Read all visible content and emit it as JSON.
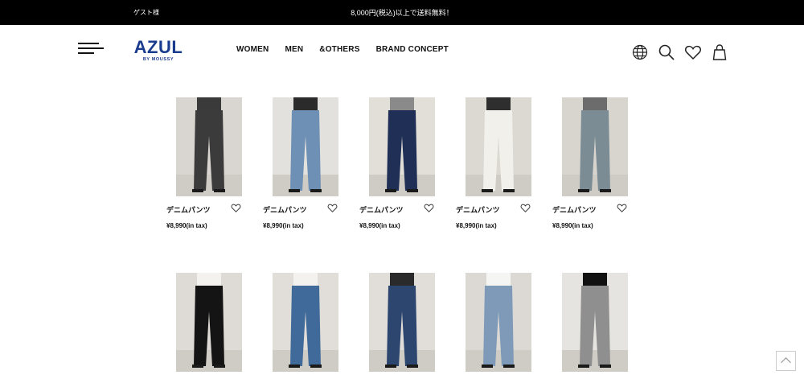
{
  "topbar": {
    "guest_label": "ゲスト様",
    "promo_text": "8,000円(税込)以上で送料無料！"
  },
  "brand": {
    "logo_main": "AZUL",
    "logo_sub": "BY MOUSSY",
    "color": "#1a3c8e"
  },
  "nav": {
    "items": [
      "WOMEN",
      "MEN",
      "&OTHERS",
      "BRAND CONCEPT"
    ]
  },
  "header_icons": [
    "globe-icon",
    "search-icon",
    "heart-icon",
    "shopping-bag-icon"
  ],
  "products": [
    {
      "name": "デニムパンツ",
      "price": "¥8,990(in tax)",
      "top_color": "#3a3a3a",
      "bottom_color": "#3b3b3b",
      "bg_color": "#d9d5d0"
    },
    {
      "name": "デニムパンツ",
      "price": "¥8,990(in tax)",
      "top_color": "#2b2b2b",
      "bottom_color": "#6f90b5",
      "bg_color": "#e3e1dd"
    },
    {
      "name": "デニムパンツ",
      "price": "¥8,990(in tax)",
      "top_color": "#8a8a8a",
      "bottom_color": "#1f2f55",
      "bg_color": "#e2ded8"
    },
    {
      "name": "デニムパンツ",
      "price": "¥8,990(in tax)",
      "top_color": "#2e2e2e",
      "bottom_color": "#f2f0ea",
      "bg_color": "#dcd8d2"
    },
    {
      "name": "デニムパンツ",
      "price": "¥8,990(in tax)",
      "top_color": "#6c6c6c",
      "bottom_color": "#7b8c94",
      "bg_color": "#d8d4ce"
    },
    {
      "name": "",
      "price": "",
      "top_color": "#f4f2ef",
      "bottom_color": "#141414",
      "bg_color": "#dedbd6"
    },
    {
      "name": "",
      "price": "",
      "top_color": "#f4f2ef",
      "bottom_color": "#3f6a9a",
      "bg_color": "#e1ddd8"
    },
    {
      "name": "",
      "price": "",
      "top_color": "#2a2a2a",
      "bottom_color": "#2d4670",
      "bg_color": "#e1ded9"
    },
    {
      "name": "",
      "price": "",
      "top_color": "#f5f5f3",
      "bottom_color": "#7e9ab8",
      "bg_color": "#dcd9d4"
    },
    {
      "name": "",
      "price": "",
      "top_color": "#111111",
      "bottom_color": "#8f8f8f",
      "bg_color": "#e6e4e0"
    }
  ]
}
